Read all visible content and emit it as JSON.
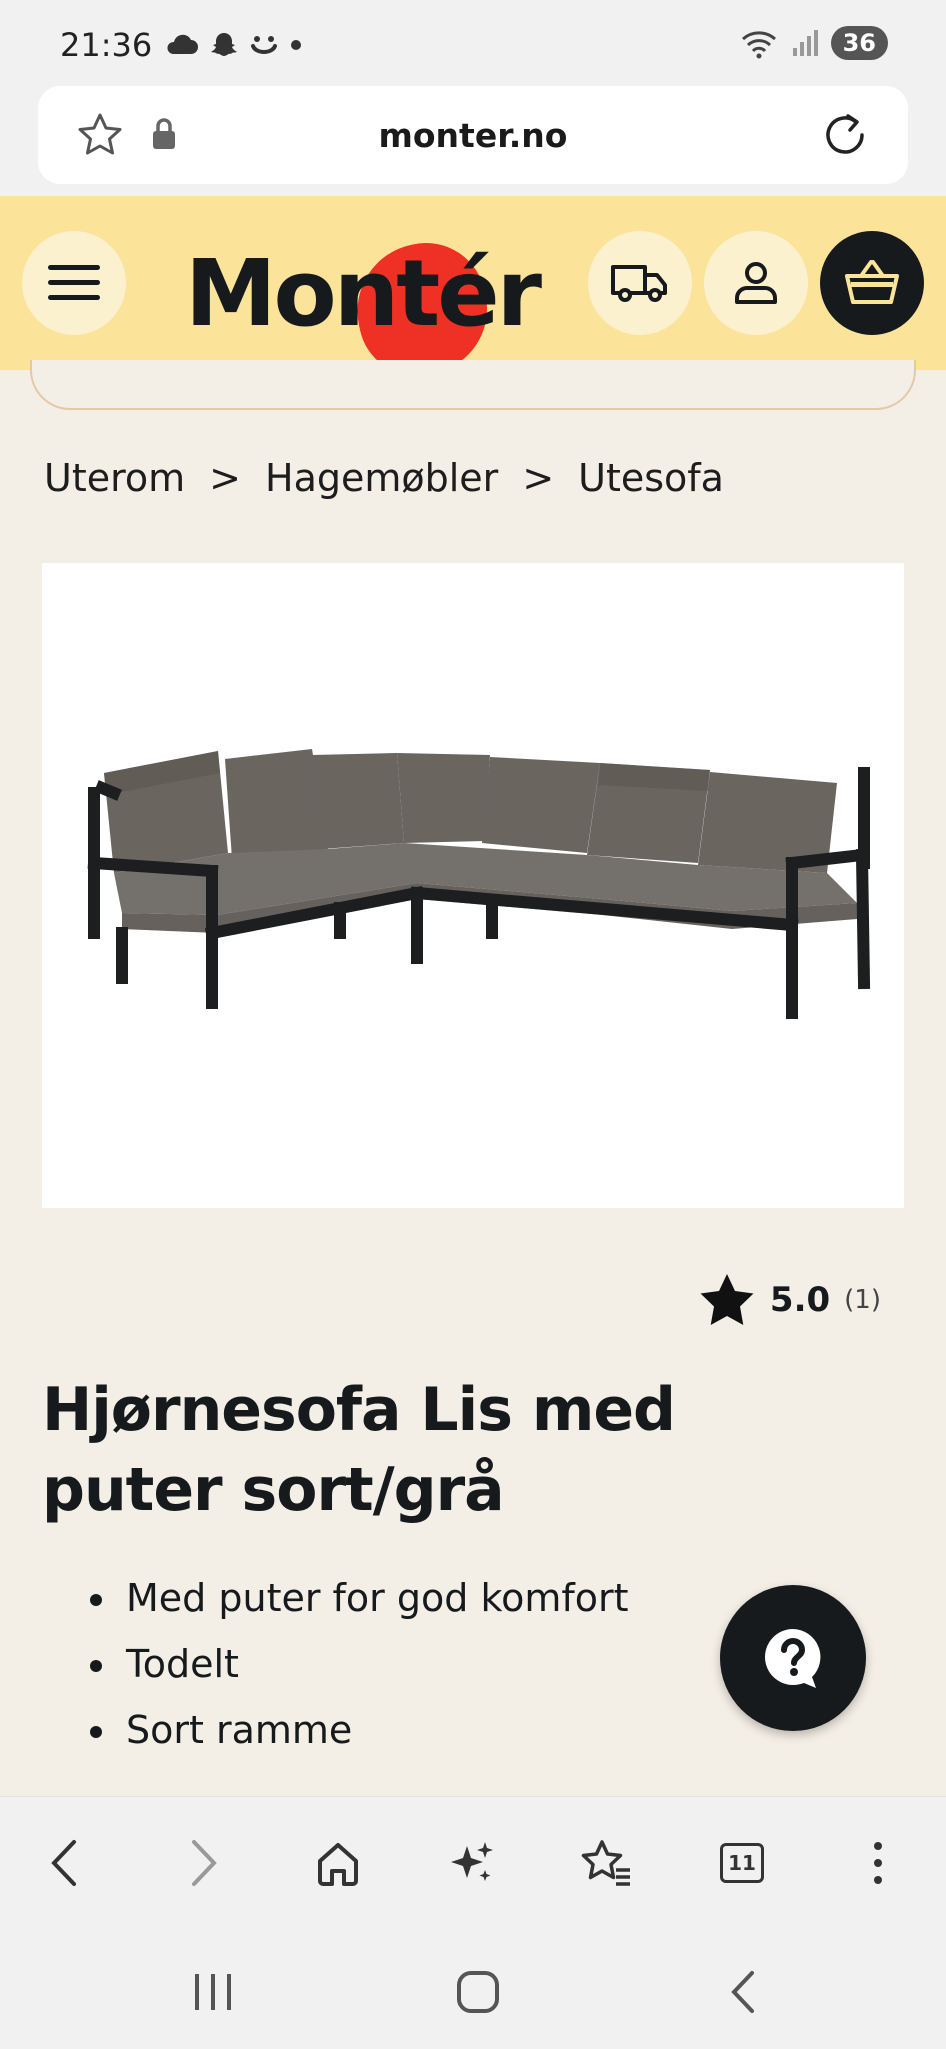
{
  "status_bar": {
    "time": "21:36",
    "left_icons": [
      "cloud-icon",
      "snapchat-icon",
      "smile-icon",
      "dot-icon"
    ],
    "right_icons": [
      "wifi-icon",
      "signal-icon"
    ],
    "battery": "36"
  },
  "browser": {
    "url": "monter.no",
    "tabs_count": "11"
  },
  "header": {
    "logo_text": "Montér",
    "logo_registered": "®",
    "brand_color": "#fbe39a",
    "logo_accent": "#ee3124"
  },
  "breadcrumb": {
    "items": [
      "Uterom",
      "Hagemøbler",
      "Utesofa"
    ],
    "separator": ">"
  },
  "product": {
    "rating_value": "5.0",
    "rating_count": "(1)",
    "title": "Hjørnesofa Lis med puter sort/grå",
    "features": [
      "Med puter for god komfort",
      "Todelt",
      "Sort ramme"
    ]
  }
}
